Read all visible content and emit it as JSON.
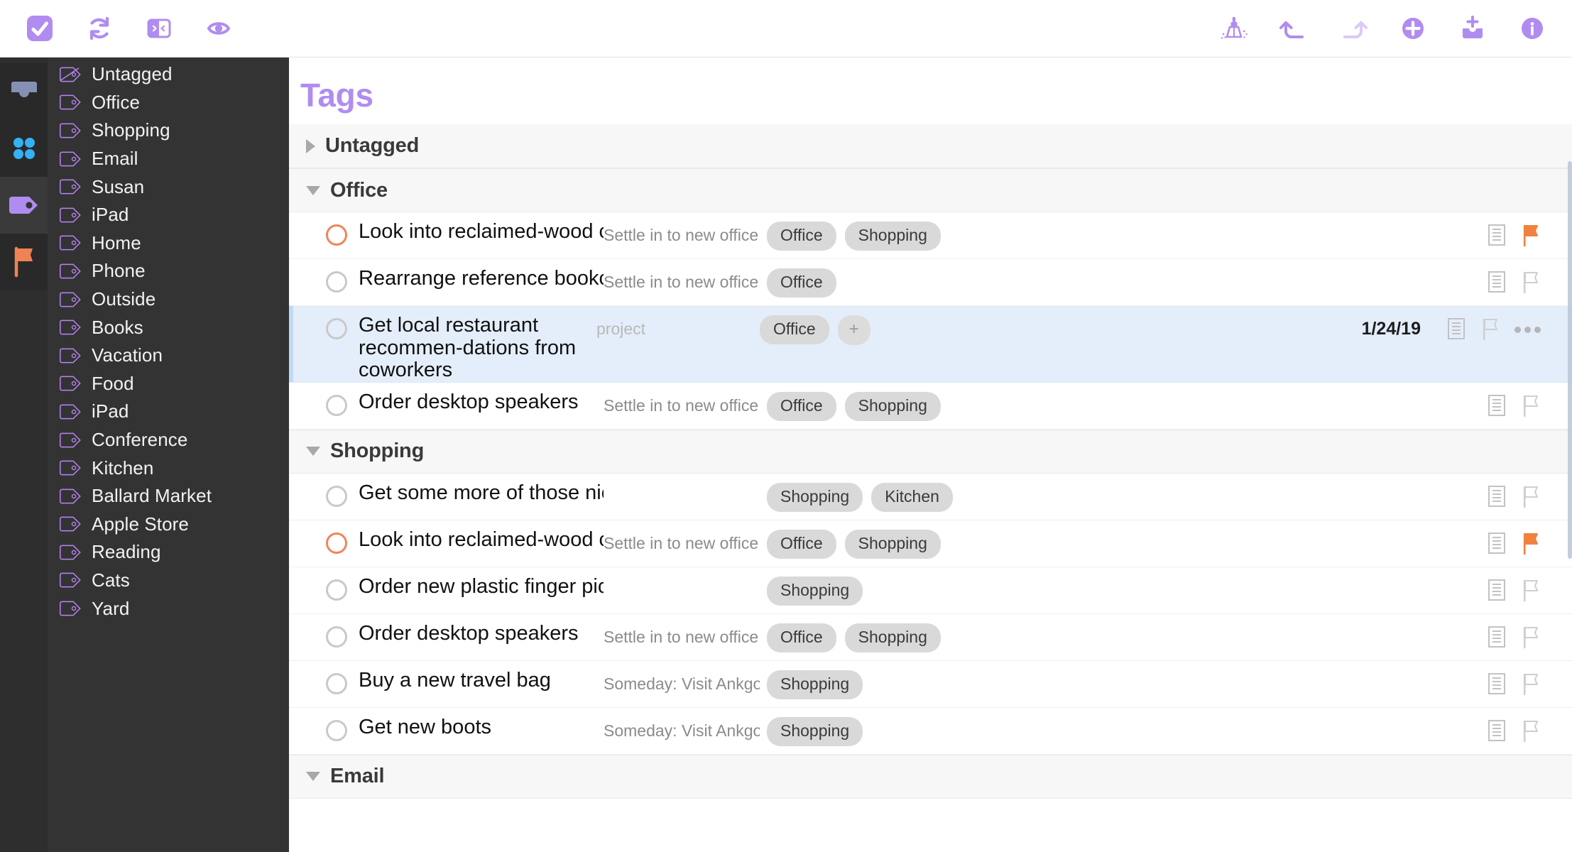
{
  "colors": {
    "accent_purple": "#b18cf0",
    "flag_orange": "#f0855a",
    "selection_blue": "#e4eefb",
    "sidebar_dark": "#333333",
    "rail_dark": "#2e2e2e",
    "chip_gray": "#d9d9d9",
    "project_blue": "#3aaef0"
  },
  "toolbar": {
    "left": [
      {
        "name": "complete-icon",
        "label": "Complete"
      },
      {
        "name": "sync-icon",
        "label": "Sync"
      },
      {
        "name": "sidebar-toggle-icon",
        "label": "Toggle Sidebar"
      },
      {
        "name": "view-options-icon",
        "label": "View Options"
      }
    ],
    "right": [
      {
        "name": "cleanup-icon",
        "label": "Clean Up"
      },
      {
        "name": "undo-icon",
        "label": "Undo"
      },
      {
        "name": "redo-icon",
        "label": "Redo"
      },
      {
        "name": "add-icon",
        "label": "New Item"
      },
      {
        "name": "inbox-add-icon",
        "label": "Add to Inbox"
      },
      {
        "name": "info-icon",
        "label": "Inspector"
      }
    ]
  },
  "rail": {
    "items": [
      {
        "name": "perspective-inbox",
        "label": "Inbox",
        "selected": false
      },
      {
        "name": "perspective-projects",
        "label": "Projects",
        "selected": false
      },
      {
        "name": "perspective-tags",
        "label": "Tags",
        "selected": true
      },
      {
        "name": "perspective-flagged",
        "label": "Flagged",
        "selected": false
      }
    ]
  },
  "sidebar": {
    "items": [
      {
        "label": "Untagged",
        "icon": "tag-untagged-icon"
      },
      {
        "label": "Office",
        "icon": "tag-icon"
      },
      {
        "label": "Shopping",
        "icon": "tag-icon"
      },
      {
        "label": "Email",
        "icon": "tag-icon"
      },
      {
        "label": "Susan",
        "icon": "tag-icon"
      },
      {
        "label": "iPad",
        "icon": "tag-icon"
      },
      {
        "label": "Home",
        "icon": "tag-icon"
      },
      {
        "label": "Phone",
        "icon": "tag-icon"
      },
      {
        "label": "Outside",
        "icon": "tag-icon"
      },
      {
        "label": "Books",
        "icon": "tag-icon"
      },
      {
        "label": "Vacation",
        "icon": "tag-icon"
      },
      {
        "label": "Food",
        "icon": "tag-icon"
      },
      {
        "label": "iPad",
        "icon": "tag-icon"
      },
      {
        "label": "Conference",
        "icon": "tag-icon"
      },
      {
        "label": "Kitchen",
        "icon": "tag-icon"
      },
      {
        "label": "Ballard Market",
        "icon": "tag-icon"
      },
      {
        "label": "Apple Store",
        "icon": "tag-icon"
      },
      {
        "label": "Reading",
        "icon": "tag-icon"
      },
      {
        "label": "Cats",
        "icon": "tag-icon"
      },
      {
        "label": "Yard",
        "icon": "tag-icon"
      }
    ]
  },
  "main": {
    "title": "Tags",
    "groups": [
      {
        "name": "Untagged",
        "expanded": false,
        "rows": []
      },
      {
        "name": "Office",
        "expanded": true,
        "rows": [
          {
            "title": "Look into reclaimed-wood conf...",
            "project": "Settle in to new office",
            "project_placeholder": false,
            "tags": [
              "Office",
              "Shopping"
            ],
            "show_add_tag": false,
            "due": "",
            "flagged": true,
            "selected": false,
            "has_note": true
          },
          {
            "title": "Rearrange reference bookcase",
            "project": "Settle in to new office",
            "project_placeholder": false,
            "tags": [
              "Office"
            ],
            "show_add_tag": false,
            "due": "",
            "flagged": false,
            "selected": false,
            "has_note": true
          },
          {
            "title": "Get local restaurant recommen-dations from coworkers",
            "project": "project",
            "project_placeholder": true,
            "tags": [
              "Office"
            ],
            "show_add_tag": true,
            "due": "1/24/19",
            "flagged": false,
            "selected": true,
            "has_note": true
          },
          {
            "title": "Order desktop speakers",
            "project": "Settle in to new office",
            "project_placeholder": false,
            "tags": [
              "Office",
              "Shopping"
            ],
            "show_add_tag": false,
            "due": "",
            "flagged": false,
            "selected": false,
            "has_note": true
          }
        ]
      },
      {
        "name": "Shopping",
        "expanded": true,
        "rows": [
          {
            "title": "Get some more of those nice d...",
            "project": "",
            "project_placeholder": false,
            "tags": [
              "Shopping",
              "Kitchen"
            ],
            "show_add_tag": false,
            "due": "",
            "flagged": false,
            "selected": false,
            "has_note": true
          },
          {
            "title": "Look into reclaimed-wood conf...",
            "project": "Settle in to new office",
            "project_placeholder": false,
            "tags": [
              "Office",
              "Shopping"
            ],
            "show_add_tag": false,
            "due": "",
            "flagged": true,
            "selected": false,
            "has_note": true
          },
          {
            "title": "Order new plastic finger picks",
            "project": "",
            "project_placeholder": false,
            "tags": [
              "Shopping"
            ],
            "show_add_tag": false,
            "due": "",
            "flagged": false,
            "selected": false,
            "has_note": true
          },
          {
            "title": "Order desktop speakers",
            "project": "Settle in to new office",
            "project_placeholder": false,
            "tags": [
              "Office",
              "Shopping"
            ],
            "show_add_tag": false,
            "due": "",
            "flagged": false,
            "selected": false,
            "has_note": true
          },
          {
            "title": "Buy a new travel bag",
            "project": "Someday: Visit Ankgor ...",
            "project_placeholder": false,
            "tags": [
              "Shopping"
            ],
            "show_add_tag": false,
            "due": "",
            "flagged": false,
            "selected": false,
            "has_note": true
          },
          {
            "title": "Get new boots",
            "project": "Someday: Visit Ankgor ...",
            "project_placeholder": false,
            "tags": [
              "Shopping"
            ],
            "show_add_tag": false,
            "due": "",
            "flagged": false,
            "selected": false,
            "has_note": true
          }
        ]
      },
      {
        "name": "Email",
        "expanded": true,
        "rows": []
      }
    ]
  }
}
